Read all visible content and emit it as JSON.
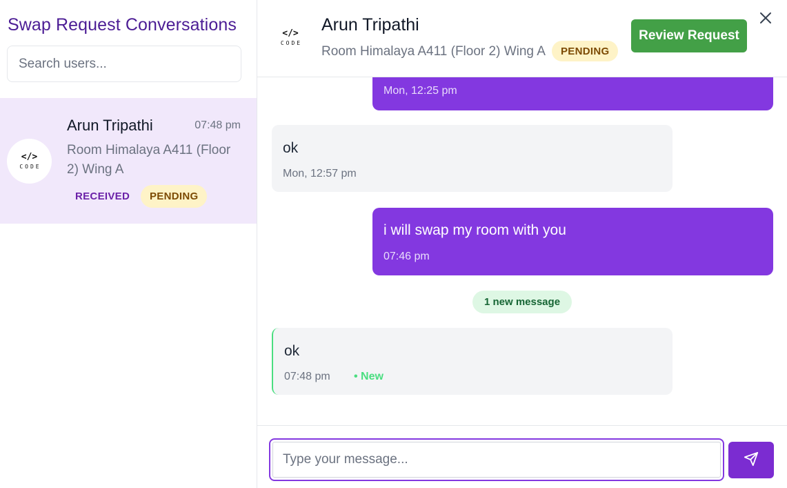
{
  "sidebar": {
    "title": "Swap Request Conversations",
    "search_placeholder": "Search users...",
    "conversations": [
      {
        "name": "Arun Tripathi",
        "time": "07:48 pm",
        "room": "Room Himalaya A411 (Floor 2) Wing A",
        "direction_badge": "RECEIVED",
        "status_badge": "PENDING",
        "avatar_logo_top": "</>",
        "avatar_logo_bottom": "CODE"
      }
    ]
  },
  "chat": {
    "header": {
      "name": "Arun Tripathi",
      "room": "Room Himalaya A411 (Floor 2) Wing A",
      "status_badge": "PENDING",
      "review_button": "Review Request",
      "avatar_logo_top": "</>",
      "avatar_logo_bottom": "CODE",
      "close_icon": "close-icon"
    },
    "messages": [
      {
        "direction": "outgoing",
        "text": "",
        "time": "Mon, 12:25 pm"
      },
      {
        "direction": "incoming",
        "text": "ok",
        "time": "Mon, 12:57 pm"
      },
      {
        "direction": "outgoing",
        "text": "i will swap my room with you",
        "time": "07:46 pm"
      },
      {
        "direction": "incoming",
        "text": "ok",
        "time": "07:48 pm",
        "new_label": "• New"
      }
    ],
    "new_message_pill": "1 new message",
    "composer": {
      "placeholder": "Type your message...",
      "send_icon": "send-icon"
    }
  },
  "colors": {
    "accent_purple": "#8338e0",
    "title_purple": "#4c1d95",
    "review_green": "#43a047",
    "pending_bg": "#fef3c7",
    "selected_conversation_bg": "#f1e8fb",
    "new_green": "#4ade80"
  }
}
